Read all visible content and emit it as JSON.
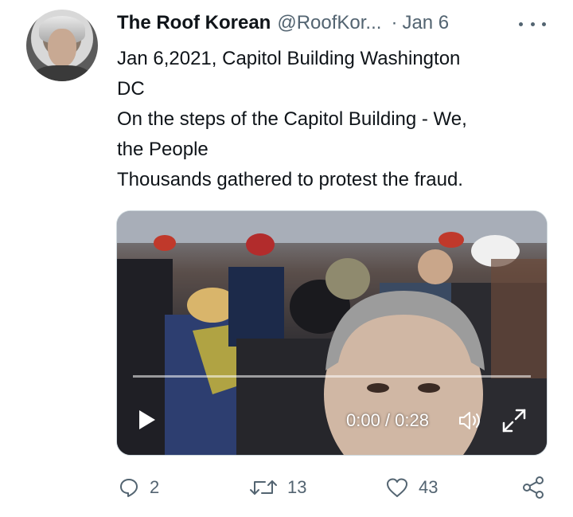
{
  "tweet": {
    "display_name": "The Roof Korean",
    "handle": "@RoofKor...",
    "separator": "·",
    "date": "Jan 6",
    "text_lines": [
      "Jan 6,2021, Capitol Building Washington",
      "DC",
      "On the steps of the Capitol Building - We,",
      "the People",
      "Thousands gathered to protest the fraud."
    ]
  },
  "video": {
    "timecode": "0:00 / 0:28",
    "progress": 0
  },
  "actions": {
    "reply_count": "2",
    "retweet_count": "13",
    "like_count": "43"
  },
  "icons": {
    "more": "more-horizontal-icon",
    "play": "play-icon",
    "volume": "volume-icon",
    "fullscreen": "fullscreen-icon",
    "reply": "reply-icon",
    "retweet": "retweet-icon",
    "like": "heart-icon",
    "share": "share-icon"
  },
  "colors": {
    "text": "#0f1419",
    "secondary": "#536471",
    "background": "#ffffff"
  }
}
